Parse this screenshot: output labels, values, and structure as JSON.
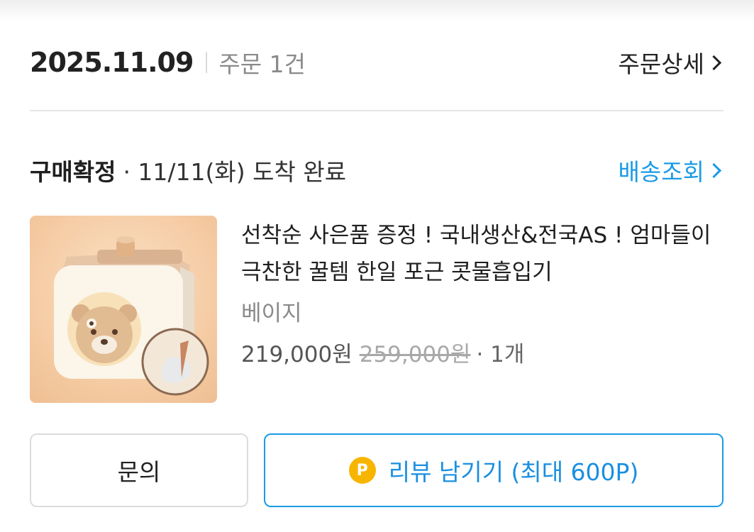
{
  "order": {
    "date": "2025.11.09",
    "count_label": "주문 1건",
    "detail_link_label": "주문상세"
  },
  "status": {
    "label": "구매확정",
    "info": "· 11/11(화) 도착 완료",
    "tracking_link_label": "배송조회"
  },
  "product": {
    "image_icon": "bear-humidifier-product-image",
    "name": "선착순 사은품 증정 ! 국내생산&전국AS ! 엄마들이 극찬한 꿀템 한일 포근 콧물흡입기",
    "option": "베이지",
    "price": "219,000원",
    "original_price": "259,000원",
    "quantity": "· 1개"
  },
  "actions": {
    "inquiry_label": "문의",
    "review_label": "리뷰 남기기 (최대 600P)",
    "point_badge": "P"
  },
  "colors": {
    "accent": "#1a9be6",
    "point": "#f7b500"
  }
}
